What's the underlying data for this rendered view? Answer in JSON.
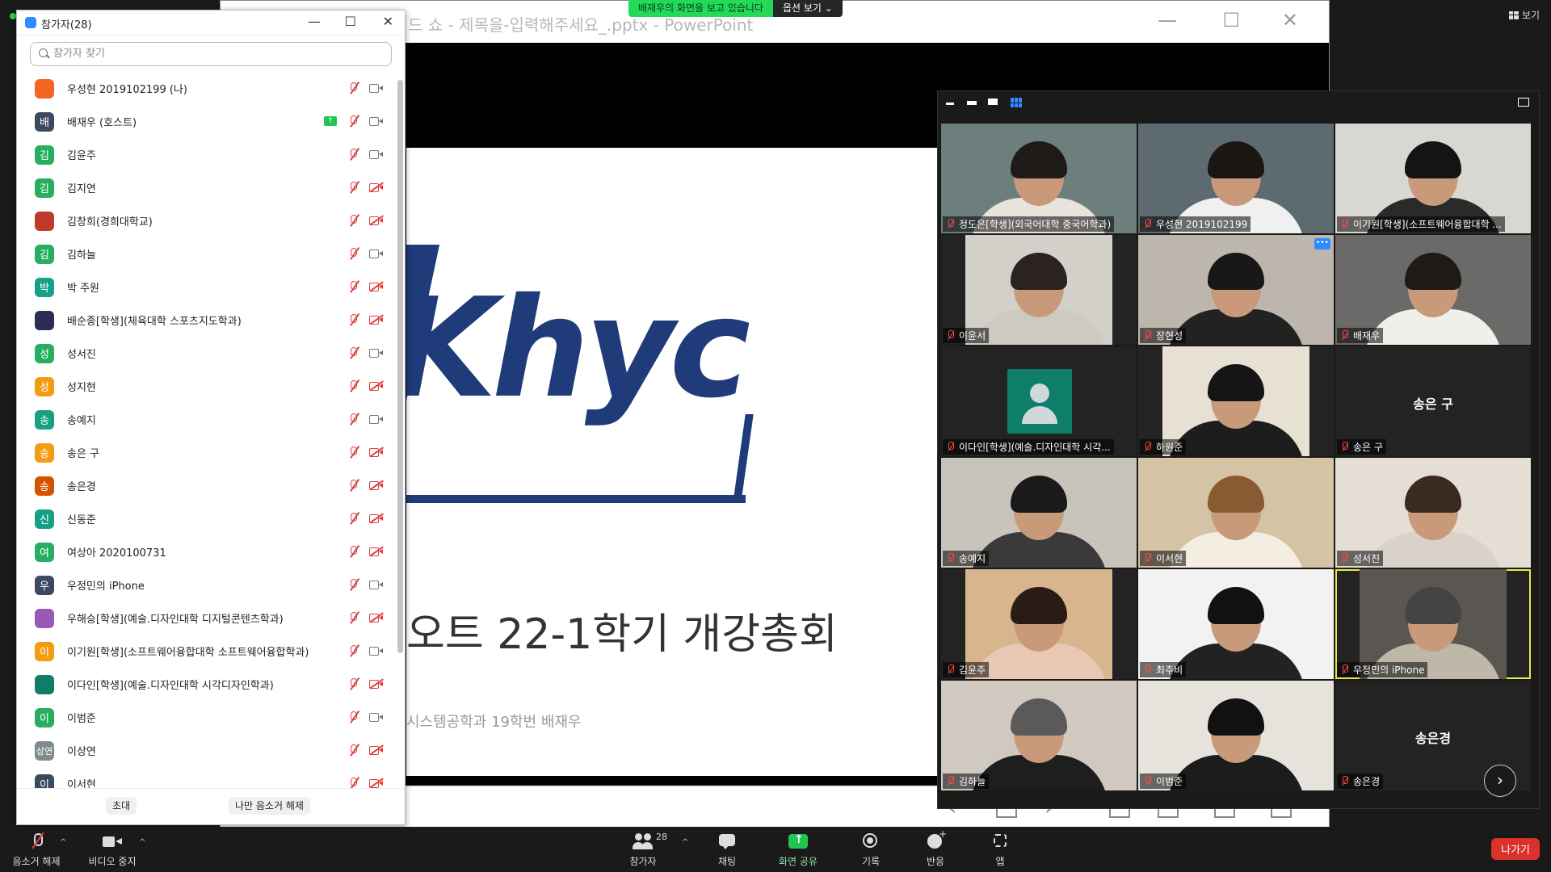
{
  "share_banner": {
    "message": "배재우의 화면을 보고 있습니다",
    "options_label": "옵션 보기 ⌄"
  },
  "view_button": {
    "label": "보기"
  },
  "ppt": {
    "title": "드 쇼  -  제목을-입력해주세요_.pptx - PowerPoint",
    "slide_title": "오트 22-1학기 개강총회",
    "slide_subtitle": "시스템공학과 19학번 배재우",
    "logo_text": "Khyc"
  },
  "participants_panel": {
    "title": "참가자(28)",
    "search_placeholder": "참가자 찾기",
    "invite_label": "초대",
    "unmute_me_label": "나만 음소거 해제",
    "items": [
      {
        "name": "우성현 2019102199 (나)",
        "avatar": "",
        "color": "#f26522",
        "cam_off": false,
        "sharing": false,
        "photo": true
      },
      {
        "name": "배재우 (호스트)",
        "avatar": "배",
        "color": "#3b4a5e",
        "cam_off": false,
        "sharing": true
      },
      {
        "name": "김윤주",
        "avatar": "김",
        "color": "#27ae60",
        "cam_off": false,
        "sharing": false
      },
      {
        "name": "김지연",
        "avatar": "김",
        "color": "#27ae60",
        "cam_off": true,
        "sharing": false
      },
      {
        "name": "김창희(경희대학교)",
        "avatar": "",
        "color": "#c0392b",
        "cam_off": true,
        "sharing": false,
        "photo": true
      },
      {
        "name": "김하늘",
        "avatar": "김",
        "color": "#27ae60",
        "cam_off": false,
        "sharing": false
      },
      {
        "name": "박 주원",
        "avatar": "박",
        "color": "#16a085",
        "cam_off": true,
        "sharing": false
      },
      {
        "name": "배순종[학생](체육대학 스포츠지도학과)",
        "avatar": "",
        "color": "#2c2c54",
        "cam_off": true,
        "sharing": false,
        "photo": true
      },
      {
        "name": "성서진",
        "avatar": "성",
        "color": "#27ae60",
        "cam_off": false,
        "sharing": false
      },
      {
        "name": "성지현",
        "avatar": "성",
        "color": "#f39c12",
        "cam_off": true,
        "sharing": false
      },
      {
        "name": "송예지",
        "avatar": "송",
        "color": "#16a085",
        "cam_off": false,
        "sharing": false
      },
      {
        "name": "송은 구",
        "avatar": "송",
        "color": "#f39c12",
        "cam_off": true,
        "sharing": false
      },
      {
        "name": "송은경",
        "avatar": "송",
        "color": "#d35400",
        "cam_off": true,
        "sharing": false
      },
      {
        "name": "신동준",
        "avatar": "신",
        "color": "#16a085",
        "cam_off": true,
        "sharing": false
      },
      {
        "name": "여상아 2020100731",
        "avatar": "여",
        "color": "#27ae60",
        "cam_off": true,
        "sharing": false
      },
      {
        "name": "우정민의 iPhone",
        "avatar": "우",
        "color": "#3b4a5e",
        "cam_off": false,
        "sharing": false
      },
      {
        "name": "우해승[학생](예술.디자인대학 디지털콘텐츠학과)",
        "avatar": "",
        "color": "#9b59b6",
        "cam_off": true,
        "sharing": false,
        "photo": true
      },
      {
        "name": "이기원[학생](소프트웨어융합대학 소프트웨어융합학과)",
        "avatar": "이",
        "color": "#f39c12",
        "cam_off": false,
        "sharing": false
      },
      {
        "name": "이다인[학생](예술.디자인대학 시각디자인학과)",
        "avatar": "",
        "color": "#0e7d6a",
        "cam_off": true,
        "sharing": false,
        "photo": true
      },
      {
        "name": "이범준",
        "avatar": "이",
        "color": "#27ae60",
        "cam_off": false,
        "sharing": false
      },
      {
        "name": "이상연",
        "avatar": "상연",
        "color": "#7f8c8d",
        "cam_off": true,
        "sharing": false
      },
      {
        "name": "이서현",
        "avatar": "이",
        "color": "#3b4a5e",
        "cam_off": true,
        "sharing": false
      }
    ]
  },
  "gallery": {
    "tiles": [
      {
        "name": "정도은[학생](외국어대학 중국어학과)",
        "bg": "#6d7f7c",
        "frame": "full",
        "shirt": "#e8e4dc",
        "hair": "#1e1a18"
      },
      {
        "name": "우성현 2019102199",
        "bg": "#5d6b70",
        "frame": "full",
        "shirt": "#f0f0f0",
        "hair": "#1a1614"
      },
      {
        "name": "이기원[학생](소프트웨어융합대학 ...",
        "bg": "#d9d7d2",
        "frame": "full",
        "shirt": "#2a2a2a",
        "hair": "#141414"
      },
      {
        "name": "이윤서",
        "bg": "#d3d0ca",
        "frame": "mid",
        "shirt": "#cfcac0",
        "hair": "#2a2320"
      },
      {
        "name": "장현성",
        "bg": "#bdb6ad",
        "frame": "full",
        "shirt": "#222",
        "hair": "#181818",
        "more": true
      },
      {
        "name": "배재우",
        "bg": "#6b6a68",
        "frame": "full",
        "shirt": "#f1efe9",
        "hair": "#1e1a18"
      },
      {
        "name": "이다인[학생](예술.디자인대학 시각...",
        "placeholder": true
      },
      {
        "name": "하원준",
        "bg": "#e7e1d4",
        "frame": "mid",
        "shirt": "#1d1d1d",
        "hair": "#151515"
      },
      {
        "name": "송은 구",
        "center_name": "송은 구"
      },
      {
        "name": "송예지",
        "bg": "#c9c4bb",
        "frame": "full",
        "shirt": "#3a3a3a",
        "hair": "#1a1a1a"
      },
      {
        "name": "이서현",
        "bg": "#d4c3a5",
        "frame": "full",
        "shirt": "#f3ede2",
        "hair": "#8a5a33"
      },
      {
        "name": "성서진",
        "bg": "#e4ded5",
        "frame": "full",
        "shirt": "#d8d2c8",
        "hair": "#3a2a22"
      },
      {
        "name": "김윤주",
        "bg": "#d9b58e",
        "frame": "mid",
        "shirt": "#e8c8b5",
        "hair": "#2a1c14"
      },
      {
        "name": "최주비",
        "bg": "#f2f2f2",
        "frame": "full",
        "shirt": "#222",
        "hair": "#111"
      },
      {
        "name": "우정민의 iPhone",
        "bg": "#5a5752",
        "frame": "mid",
        "shirt": "#bfb7a8",
        "hair": "#444",
        "active": true
      },
      {
        "name": "김하늘",
        "bg": "#cfc9c0",
        "frame": "full",
        "shirt": "#1e1e1e",
        "hair": "#5a5a5a"
      },
      {
        "name": "이범준",
        "bg": "#e6e3dd",
        "frame": "full",
        "shirt": "#1c1c1c",
        "hair": "#111"
      },
      {
        "name": "송은경",
        "center_name": "송은경"
      }
    ]
  },
  "toolbar": {
    "unmute": "음소거 해제",
    "stop_video": "비디오 중지",
    "participants": "참가자",
    "participants_count": "28",
    "chat": "채팅",
    "share_screen": "화면 공유",
    "record": "기록",
    "reactions": "반응",
    "apps": "앱",
    "leave": "나가기"
  }
}
